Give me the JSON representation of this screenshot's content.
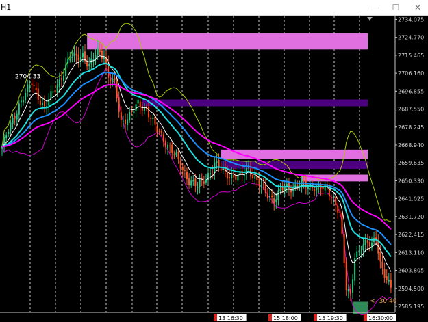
{
  "window": {
    "title": "H1",
    "min_glyph": "—",
    "max_glyph": "☐",
    "close_glyph": "✕"
  },
  "colors": {
    "background": "#000000",
    "grid": "#c8c8c8",
    "bull": "#22cc88",
    "bear": "#ff5522",
    "ma_white": "#ffffff",
    "ma_blue": "#1e90ff",
    "ma_cyan": "#20e0e0",
    "ma_magenta": "#ff00ff",
    "band_upper": "#aacc00",
    "band_lower": "#cc00cc",
    "zone_pink": "#e070e0",
    "zone_purple": "#4a0080",
    "zone_green": "#2e8b57",
    "label_orange": "#f0a050"
  },
  "chart_data": {
    "type": "candlestick",
    "timeframe": "H1",
    "ylim": [
      2582.0,
      2736.0
    ],
    "price_ticks": [
      "2734.075",
      "2724.770",
      "2715.465",
      "2706.160",
      "2696.855",
      "2687.550",
      "2678.245",
      "2668.940",
      "2659.635",
      "2650.330",
      "2641.025",
      "2631.720",
      "2622.415",
      "2613.110",
      "2603.805",
      "2594.500",
      "2585.195"
    ],
    "time_labels": [
      "13 16:30",
      "15 18:00",
      "15 19:30",
      "16:30:00"
    ],
    "annotations": {
      "peak_price_label": "2704.33",
      "countdown_label": "<- 30:40"
    },
    "zones": [
      {
        "color": "zone_pink",
        "from_index": 40,
        "to_index": -1,
        "price_top": 2727.0,
        "price_bottom": 2718.5
      },
      {
        "color": "zone_purple",
        "from_index": 66,
        "to_index": -1,
        "price_top": 2692.5,
        "price_bottom": 2689.0
      },
      {
        "color": "zone_pink",
        "from_index": 103,
        "to_index": -1,
        "price_top": 2666.5,
        "price_bottom": 2661.5
      },
      {
        "color": "zone_purple",
        "from_index": 103,
        "to_index": -1,
        "price_top": 2660.5,
        "price_bottom": 2656.5
      },
      {
        "color": "zone_pink",
        "from_index": 141,
        "to_index": -1,
        "price_top": 2653.5,
        "price_bottom": 2650.0
      },
      {
        "color": "zone_green",
        "from_index": 165,
        "to_index": -1,
        "price_top": 2587.5,
        "price_bottom": 2581.0
      }
    ],
    "close_waypoints": [
      [
        0,
        2668
      ],
      [
        8,
        2690
      ],
      [
        14,
        2701
      ],
      [
        20,
        2688
      ],
      [
        26,
        2700
      ],
      [
        32,
        2714
      ],
      [
        38,
        2716
      ],
      [
        41,
        2709
      ],
      [
        45,
        2718
      ],
      [
        48,
        2716
      ],
      [
        50,
        2704
      ],
      [
        53,
        2700
      ],
      [
        56,
        2681
      ],
      [
        60,
        2684
      ],
      [
        64,
        2690
      ],
      [
        68,
        2688
      ],
      [
        72,
        2678
      ],
      [
        76,
        2672
      ],
      [
        80,
        2666
      ],
      [
        84,
        2658
      ],
      [
        88,
        2651
      ],
      [
        92,
        2647
      ],
      [
        96,
        2652
      ],
      [
        100,
        2659
      ],
      [
        104,
        2655
      ],
      [
        108,
        2653
      ],
      [
        112,
        2652
      ],
      [
        116,
        2657
      ],
      [
        120,
        2650
      ],
      [
        124,
        2644
      ],
      [
        128,
        2641
      ],
      [
        132,
        2646
      ],
      [
        136,
        2647
      ],
      [
        140,
        2649
      ],
      [
        144,
        2647
      ],
      [
        148,
        2648
      ],
      [
        152,
        2646
      ],
      [
        156,
        2641
      ],
      [
        159,
        2634
      ],
      [
        162,
        2594
      ],
      [
        164,
        2590
      ],
      [
        166,
        2612
      ],
      [
        170,
        2617
      ],
      [
        174,
        2617
      ],
      [
        176,
        2622
      ],
      [
        178,
        2608
      ],
      [
        181,
        2598
      ],
      [
        183,
        2594
      ]
    ],
    "bull_ratio_hint": 0.5
  }
}
